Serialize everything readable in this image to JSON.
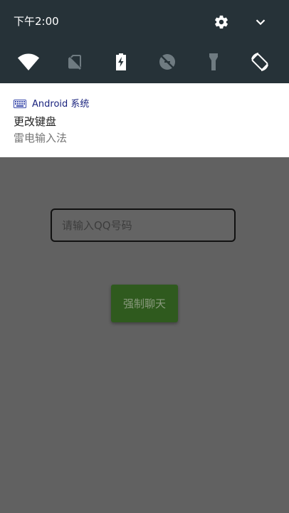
{
  "status_bar": {
    "time": "下午2:00"
  },
  "quick_settings": {
    "icons": [
      "settings-icon",
      "expand-chevron-icon",
      "wifi-icon",
      "no-sim-icon",
      "battery-charging-icon",
      "data-saver-off-icon",
      "flashlight-icon",
      "auto-rotate-icon"
    ]
  },
  "notification": {
    "app_name": "Android 系统",
    "title": "更改键盘",
    "text": "雷电输入法"
  },
  "main": {
    "qq_input_placeholder": "请输入QQ号码",
    "chat_button_label": "强制聊天"
  },
  "colors": {
    "shade": "#263238",
    "scrim": "#616161",
    "button": "#2f5a1e"
  }
}
